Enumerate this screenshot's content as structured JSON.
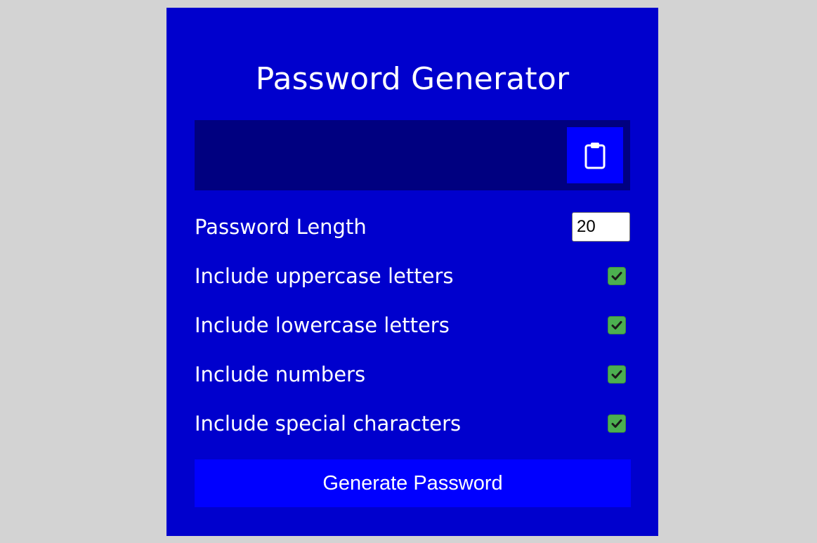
{
  "app": {
    "title": "Password Generator"
  },
  "result": {
    "password": "",
    "copy_icon": "clipboard-icon"
  },
  "settings": {
    "length": {
      "label": "Password Length",
      "value": "20"
    },
    "uppercase": {
      "label": "Include uppercase letters",
      "checked": true
    },
    "lowercase": {
      "label": "Include lowercase letters",
      "checked": true
    },
    "numbers": {
      "label": "Include numbers",
      "checked": true
    },
    "symbols": {
      "label": "Include special characters",
      "checked": true
    }
  },
  "generate": {
    "label": "Generate Password"
  },
  "colors": {
    "page_background": "#d3d3d3",
    "card_background": "#0000cd",
    "result_background": "#000080",
    "button_background": "#0000ff",
    "checkbox_checked": "#4caf50",
    "text": "#ffffff"
  }
}
